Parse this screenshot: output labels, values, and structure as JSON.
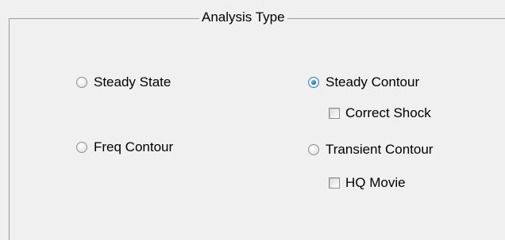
{
  "group": {
    "title": "Analysis Type"
  },
  "options": {
    "steady_state": {
      "label": "Steady State",
      "checked": false
    },
    "steady_contour": {
      "label": "Steady Contour",
      "checked": true
    },
    "correct_shock": {
      "label": "Correct Shock",
      "checked": false
    },
    "freq_contour": {
      "label": "Freq Contour",
      "checked": false
    },
    "transient_contour": {
      "label": "Transient Contour",
      "checked": false
    },
    "hq_movie": {
      "label": "HQ Movie",
      "checked": false
    }
  },
  "colors": {
    "selected_radio_accent": "#1f6fb3",
    "group_border": "#9a9a9a",
    "background": "#f0f0f0"
  }
}
